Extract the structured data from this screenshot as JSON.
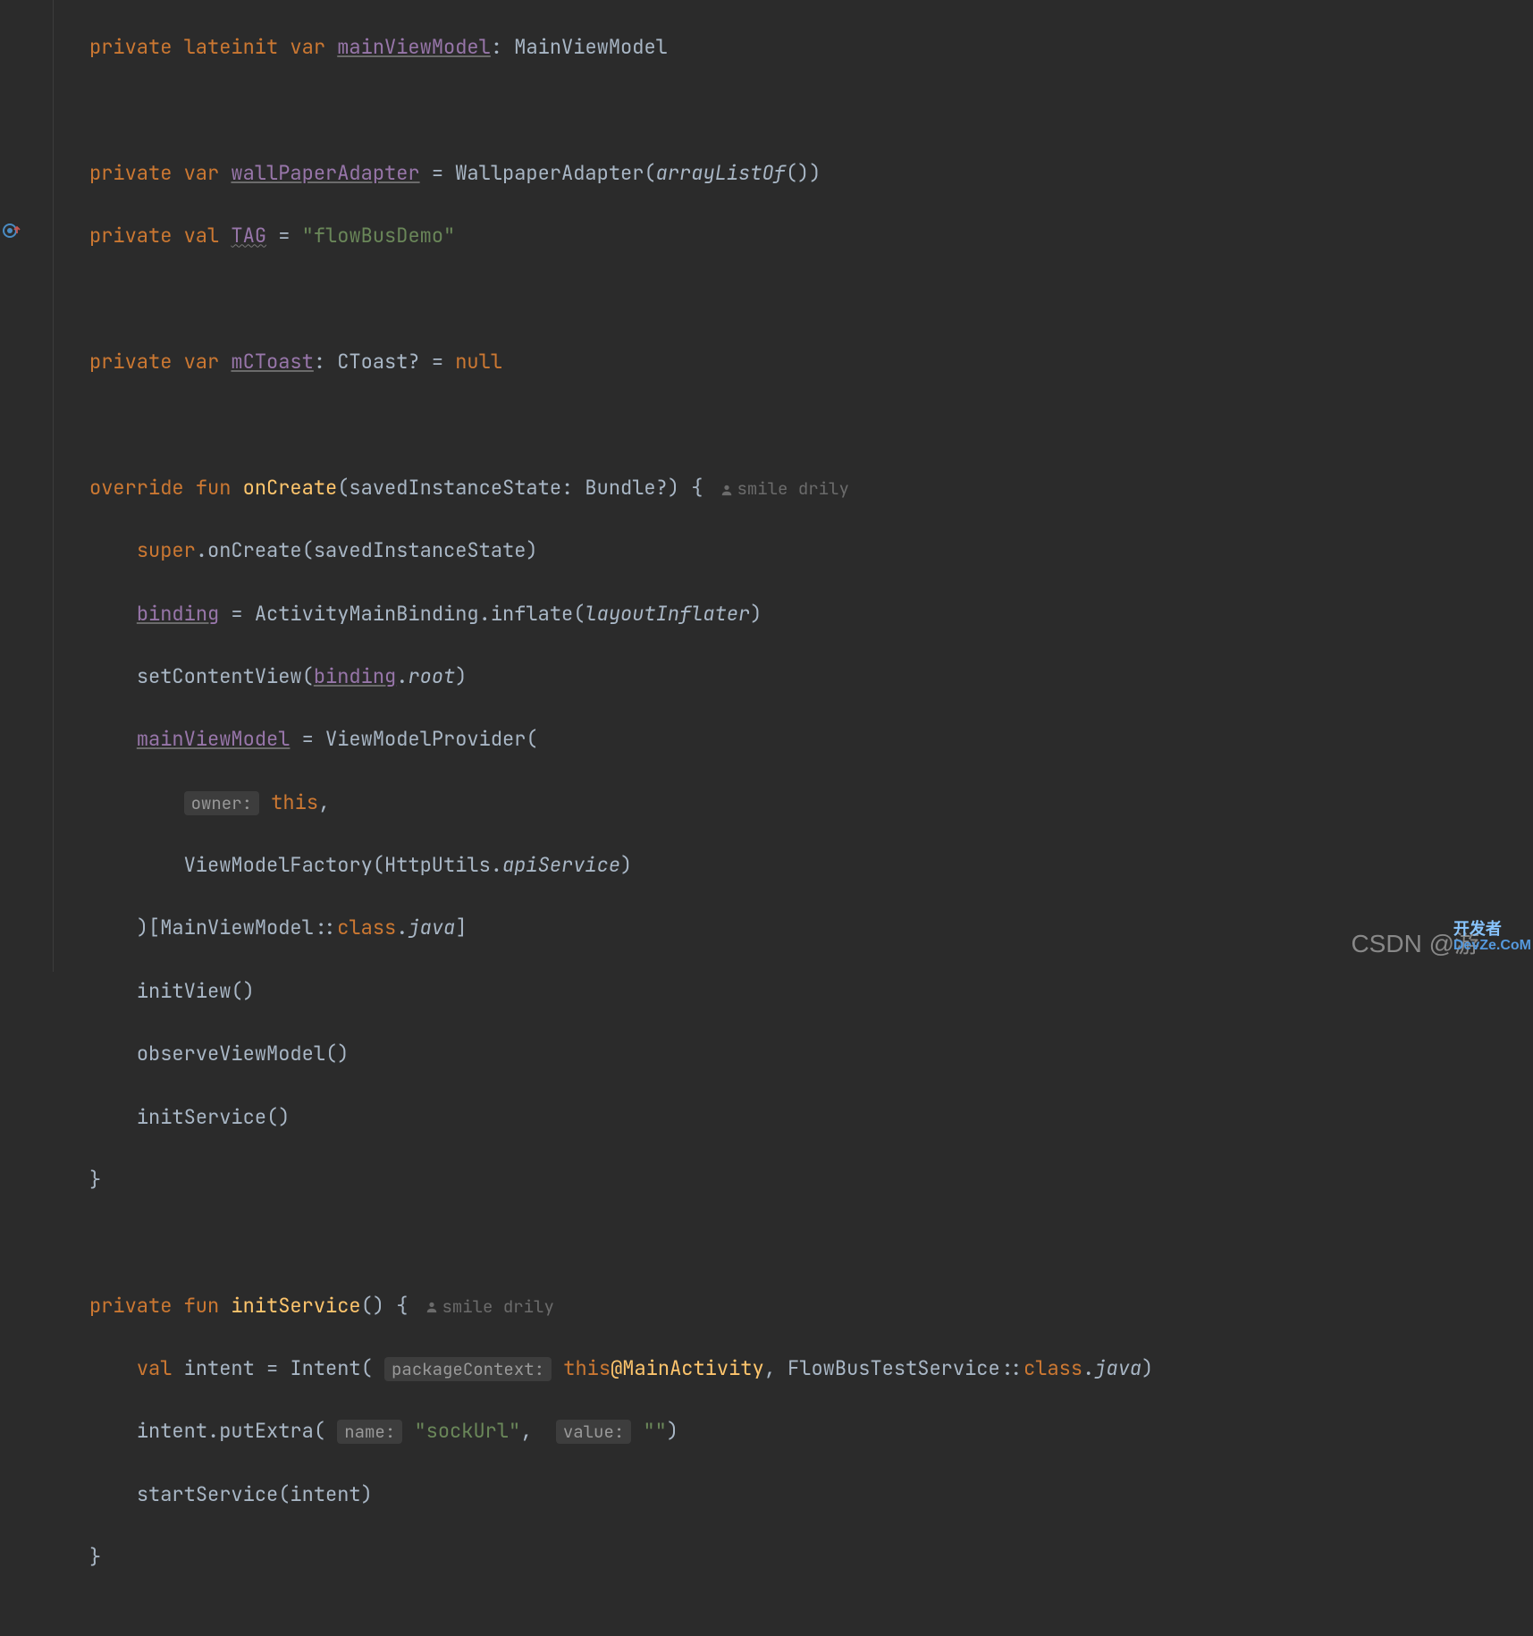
{
  "code": {
    "line1": {
      "kw1": "private",
      "kw2": "lateinit",
      "kw3": "var",
      "field": "mainViewModel",
      "colon": ": MainViewModel"
    },
    "line3": {
      "kw1": "private",
      "kw2": "var",
      "field": "wallPaperAdapter",
      "eq": " = WallpaperAdapter(",
      "param": "arrayListOf",
      "close": "())"
    },
    "line4": {
      "kw1": "private",
      "kw2": "val",
      "field": "TAG",
      "eq": " = ",
      "str": "\"flowBusDemo\""
    },
    "line6": {
      "kw1": "private",
      "kw2": "var",
      "field": "mCToast",
      "type": ": CToast? = ",
      "null": "null"
    },
    "line8": {
      "kw1": "override",
      "kw2": "fun",
      "fn": "onCreate",
      "params": "(savedInstanceState: Bundle?) {",
      "author": "smile drily"
    },
    "line9": {
      "kw": "super",
      "rest": ".onCreate(savedInstanceState)"
    },
    "line10": {
      "field": "binding",
      "eq": " = ActivityMainBinding.inflate(",
      "param": "layoutInflater",
      "close": ")"
    },
    "line11": {
      "fn": "setContentView(",
      "field": "binding",
      "dot": ".",
      "prop": "root",
      "close": ")"
    },
    "line12": {
      "field": "mainViewModel",
      "eq": " = ViewModelProvider("
    },
    "line13": {
      "hint": "owner:",
      "kw": "this",
      "comma": ","
    },
    "line14": {
      "txt": "ViewModelFactory(HttpUtils.",
      "prop": "apiService",
      "close": ")"
    },
    "line15": {
      "open": ")[MainViewModel::",
      "kw": "class",
      "dot": ".",
      "prop": "java",
      "close": "]"
    },
    "line16": "initView()",
    "line17": "observeViewModel()",
    "line18": "initService()",
    "line19": "}",
    "line21": {
      "kw1": "private",
      "kw2": "fun",
      "fn": "initService",
      "params": "() {",
      "author": "smile drily"
    },
    "line22": {
      "kw1": "val",
      "var": "intent = Intent(",
      "hint": "packageContext:",
      "kw2": "this",
      "at": "@MainActivity",
      "rest": ", FlowBusTestService::",
      "kw3": "class",
      "dot": ".",
      "prop": "java",
      "close": ")"
    },
    "line23": {
      "txt": "intent.putExtra(",
      "hint1": "name:",
      "str1": "\"sockUrl\"",
      "comma": ", ",
      "hint2": "value:",
      "str2": "\"\"",
      "close": ")"
    },
    "line24": "startService(intent)",
    "line25": "}"
  },
  "watermark": {
    "text": "CSDN @游",
    "logo_top": "开发者",
    "logo_bottom": "DevZe.CoM"
  }
}
